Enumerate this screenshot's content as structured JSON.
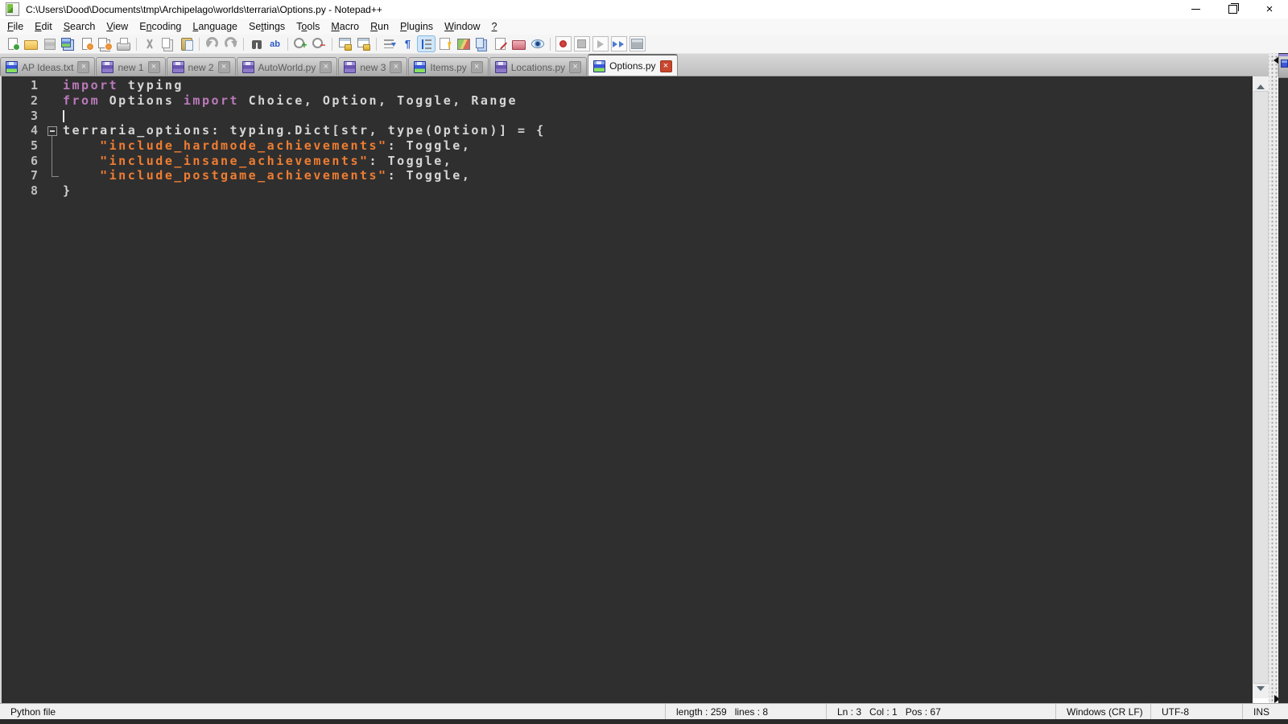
{
  "window": {
    "title": "C:\\Users\\Dood\\Documents\\tmp\\Archipelago\\worlds\\terraria\\Options.py - Notepad++",
    "controls": [
      "minimize",
      "maximize-restore",
      "close"
    ]
  },
  "menu": {
    "items": [
      {
        "id": "file",
        "label": "File",
        "underline": 0
      },
      {
        "id": "edit",
        "label": "Edit",
        "underline": 0
      },
      {
        "id": "search",
        "label": "Search",
        "underline": 0
      },
      {
        "id": "view",
        "label": "View",
        "underline": 0
      },
      {
        "id": "encoding",
        "label": "Encoding",
        "underline": 1
      },
      {
        "id": "language",
        "label": "Language",
        "underline": 0
      },
      {
        "id": "settings",
        "label": "Settings",
        "underline": 2
      },
      {
        "id": "tools",
        "label": "Tools",
        "underline": 1
      },
      {
        "id": "macro",
        "label": "Macro",
        "underline": 0
      },
      {
        "id": "run",
        "label": "Run",
        "underline": 0
      },
      {
        "id": "plugins",
        "label": "Plugins",
        "underline": 0
      },
      {
        "id": "window",
        "label": "Window",
        "underline": 0
      },
      {
        "id": "help",
        "label": "?",
        "underline": 0
      }
    ]
  },
  "toolbar": {
    "items": [
      "new-file",
      "open-file",
      "save-file",
      "save-all",
      "close-file",
      "close-all",
      "print",
      "|",
      "cut",
      "copy",
      "paste",
      "|",
      "undo",
      "redo",
      "|",
      "find",
      "replace",
      "|",
      "zoom-in",
      "zoom-out",
      "|",
      "sync-vertical",
      "sync-horizontal",
      "|",
      "word-wrap",
      "show-all-characters",
      "show-indent-guide",
      "function-list",
      "document-map",
      "document-switcher",
      "edit-marker",
      "folder-as-workspace",
      "monitoring",
      "|",
      "macro-record",
      "macro-stop",
      "macro-play",
      "macro-run-multiple",
      "macro-save"
    ],
    "active": [
      "show-indent-guide"
    ],
    "framed": [
      "macro-record",
      "macro-stop",
      "macro-play",
      "macro-run-multiple",
      "macro-save"
    ]
  },
  "tabs": [
    {
      "label": "AP Ideas.txt",
      "floppy": "blue",
      "active": false,
      "close_glyph": "×"
    },
    {
      "label": "new 1",
      "floppy": "purple",
      "active": false,
      "close_glyph": "×"
    },
    {
      "label": "new 2",
      "floppy": "purple",
      "active": false,
      "close_glyph": "×"
    },
    {
      "label": "AutoWorld.py",
      "floppy": "purple",
      "active": false,
      "close_glyph": "×"
    },
    {
      "label": "new 3",
      "floppy": "purple",
      "active": false,
      "close_glyph": "×"
    },
    {
      "label": "Items.py",
      "floppy": "blue",
      "active": false,
      "close_glyph": "×"
    },
    {
      "label": "Locations.py",
      "floppy": "purple",
      "active": false,
      "close_glyph": "×"
    },
    {
      "label": "Options.py",
      "floppy": "blue",
      "active": true,
      "close_glyph": "×"
    }
  ],
  "editor": {
    "colors": {
      "background": "#2f2f2f",
      "keyword": "#bb79bb",
      "string": "#ef7d32",
      "default": "#d6d6d6",
      "line_number": "#bdbdbd"
    },
    "lines": [
      {
        "num": 1,
        "fold": "",
        "segments": [
          [
            "kw",
            "import"
          ],
          [
            "d",
            " typing"
          ]
        ]
      },
      {
        "num": 2,
        "fold": "",
        "segments": [
          [
            "kw",
            "from"
          ],
          [
            "d",
            " Options "
          ],
          [
            "kw",
            "import"
          ],
          [
            "d",
            " Choice, Option, Toggle, Range"
          ]
        ]
      },
      {
        "num": 3,
        "fold": "",
        "caret": true,
        "segments": []
      },
      {
        "num": 4,
        "fold": "open",
        "segments": [
          [
            "d",
            "terraria_options: typing.Dict[str, type(Option)] = {"
          ]
        ]
      },
      {
        "num": 5,
        "fold": "mid",
        "segments": [
          [
            "d",
            "    "
          ],
          [
            "str",
            "\"include_hardmode_achievements\""
          ],
          [
            "d",
            ": Toggle,"
          ]
        ]
      },
      {
        "num": 6,
        "fold": "mid",
        "segments": [
          [
            "d",
            "    "
          ],
          [
            "str",
            "\"include_insane_achievements\""
          ],
          [
            "d",
            ": Toggle,"
          ]
        ]
      },
      {
        "num": 7,
        "fold": "end",
        "segments": [
          [
            "d",
            "    "
          ],
          [
            "str",
            "\"include_postgame_achievements\""
          ],
          [
            "d",
            ": Toggle,"
          ]
        ]
      },
      {
        "num": 8,
        "fold": "",
        "segments": [
          [
            "d",
            "}"
          ]
        ]
      }
    ]
  },
  "status_bar": {
    "doc_type": "Python file",
    "length_lines": "length : 259   lines : 8",
    "position": "Ln : 3   Col : 1   Pos : 67",
    "eol": "Windows (CR LF)",
    "encoding": "UTF-8",
    "mode": "INS"
  }
}
